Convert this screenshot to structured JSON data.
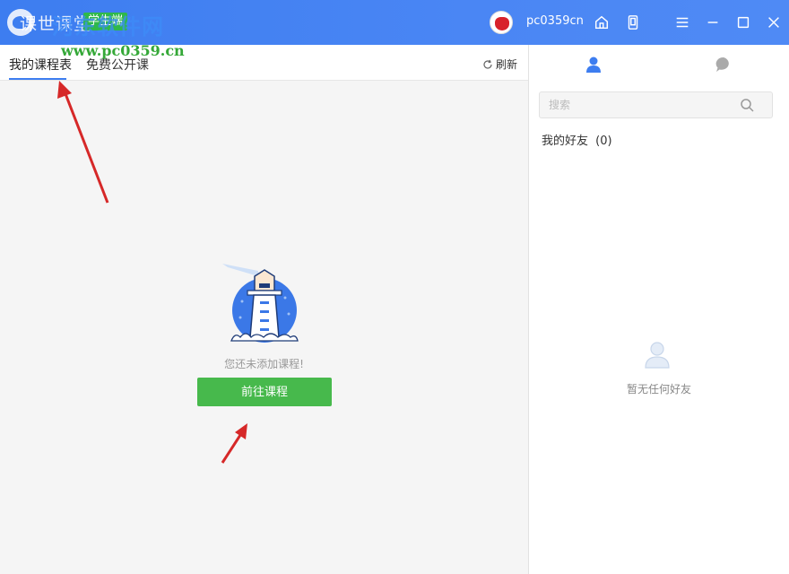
{
  "titlebar": {
    "app_title": "课世课堂",
    "role_badge": "学生端",
    "watermark_title": "河东软件网",
    "watermark_url": "www.pc0359.cn",
    "username": "pc0359cn",
    "icons": [
      "home-icon",
      "mobile-icon",
      "menu-icon",
      "minimize-icon",
      "maximize-icon",
      "close-icon"
    ],
    "accent_color": "#3d7df0"
  },
  "left": {
    "tabs": [
      {
        "label": "我的课程表",
        "active": true
      },
      {
        "label": "免费公开课",
        "active": false
      }
    ],
    "refresh_label": "刷新",
    "empty_text": "您还未添加课程!",
    "go_button": "前往课程",
    "button_color": "#47b94c"
  },
  "right": {
    "tabs": [
      "contacts-icon",
      "chat-icon"
    ],
    "search_placeholder": "搜索",
    "friends_label": "我的好友",
    "friends_count": "(0)",
    "empty_friends_text": "暂无任何好友"
  }
}
